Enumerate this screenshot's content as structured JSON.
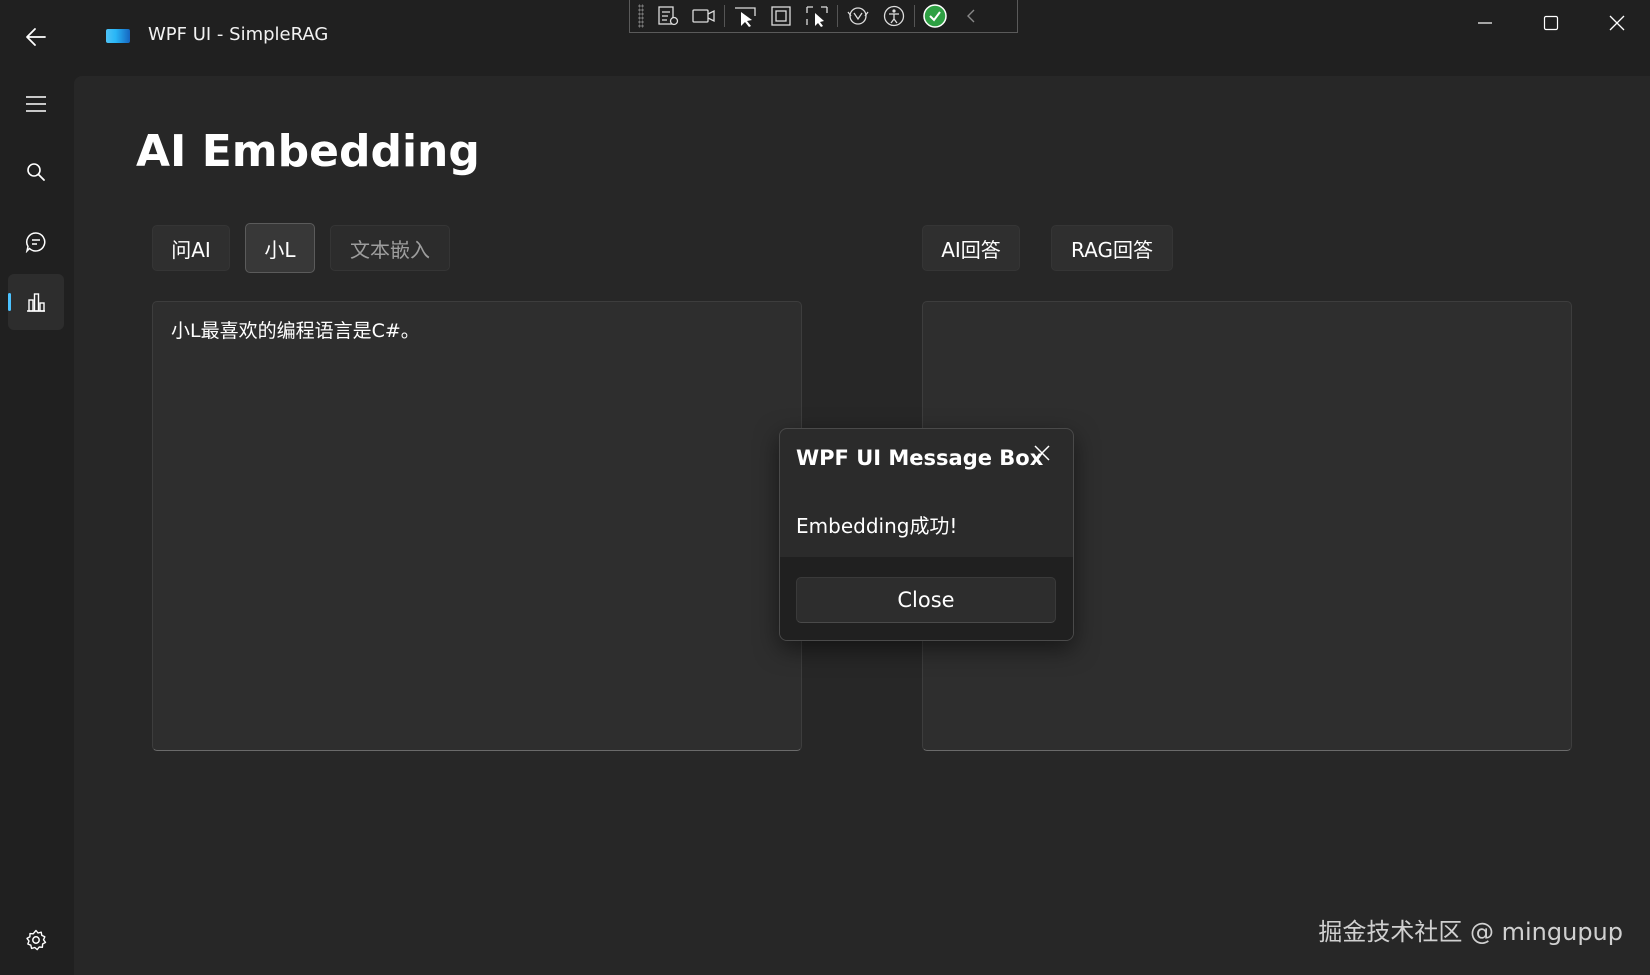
{
  "window": {
    "title": "WPF UI - SimpleRAG"
  },
  "page": {
    "title": "AI Embedding"
  },
  "buttons": {
    "ask_ai": "问AI",
    "xiao_l": "小L",
    "text_embed": "文本嵌入",
    "ai_answer": "AI回答",
    "rag_answer": "RAG回答"
  },
  "input_box": {
    "value": "小L最喜欢的编程语言是C#。"
  },
  "output_box": {
    "value": ""
  },
  "message_box": {
    "title": "WPF UI Message Box",
    "message": "Embedding成功!",
    "close_label": "Close"
  },
  "watermark": "掘金技术社区 @ mingupup",
  "colors": {
    "background": "#202020",
    "content": "#272727",
    "accent": "#4cc2ff",
    "debug_ok": "#2ea043"
  },
  "nav": {
    "items": [
      "menu-icon",
      "search-icon",
      "chat-icon",
      "chart-icon"
    ],
    "active": "chart-icon",
    "footer": "settings-icon"
  },
  "debug_toolbar": {
    "icons": [
      "visual-tree-icon",
      "record-icon",
      "select-element-icon",
      "display-layout-icon",
      "track-focus-icon",
      "hot-reload-icon",
      "accessibility-icon",
      "status-ok-icon",
      "collapse-icon"
    ]
  }
}
